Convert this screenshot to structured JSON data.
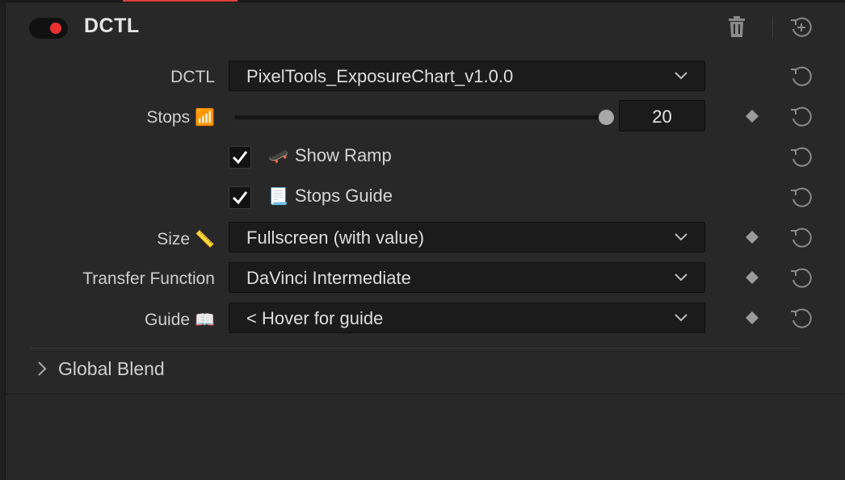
{
  "header": {
    "title": "DCTL",
    "toggle_on": true,
    "toggle_color": "#ec2f2f",
    "delete_icon": "trash-icon",
    "add_icon": "reset-add-icon"
  },
  "params": {
    "dctl": {
      "label": "DCTL",
      "value": "PixelTools_ExposureChart_v1.0.0"
    },
    "stops": {
      "label": "Stops",
      "icon": "📶",
      "value": "20",
      "slider_fraction": 1.0
    },
    "show_ramp": {
      "label": "Show Ramp",
      "icon": "🛹",
      "checked": true
    },
    "stops_guide": {
      "label": "Stops Guide",
      "icon": "📃",
      "checked": true
    },
    "size": {
      "label": "Size",
      "icon": "📏",
      "value": "Fullscreen (with value)"
    },
    "transfer": {
      "label": "Transfer Function",
      "value": "DaVinci Intermediate"
    },
    "guide": {
      "label": "Guide",
      "icon": "📖",
      "value": "< Hover for guide"
    }
  },
  "section": {
    "label": "Global Blend",
    "expanded": false
  },
  "colors": {
    "accent": "#e0433a",
    "panel": "#282828",
    "field": "#1b1b1b"
  }
}
